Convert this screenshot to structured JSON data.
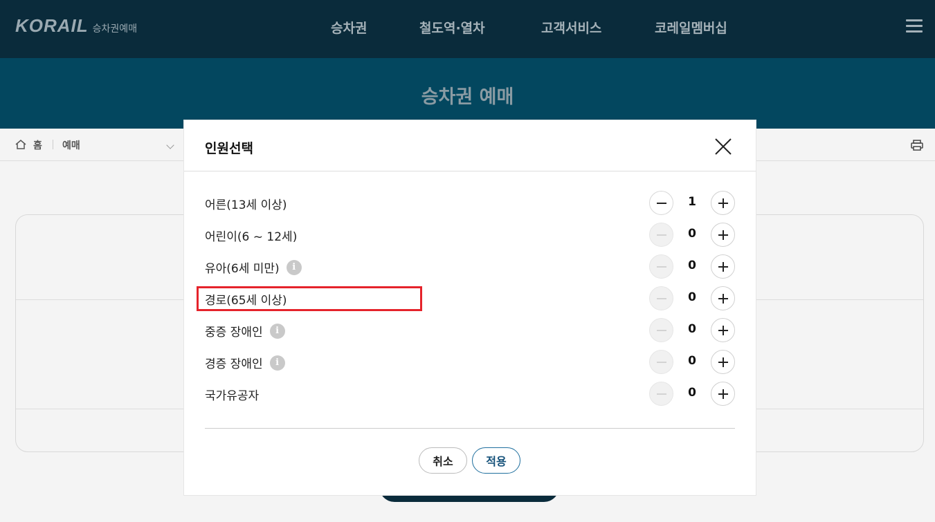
{
  "header": {
    "logo": "KORAIL",
    "logo_sub": "승차권예매",
    "nav": [
      "승차권",
      "철도역·열차",
      "고객서비스",
      "코레일멤버십"
    ]
  },
  "hero": {
    "title": "승차권 예매"
  },
  "breadcrumb": {
    "home": "홈",
    "current": "예매"
  },
  "modal": {
    "title": "인원선택",
    "passengers": [
      {
        "label": "어른(13세 이상)",
        "count": "1",
        "info": false,
        "minus_enabled": true
      },
      {
        "label": "어린이(6 ~ 12세)",
        "count": "0",
        "info": false,
        "minus_enabled": false
      },
      {
        "label": "유아(6세 미만)",
        "count": "0",
        "info": true,
        "minus_enabled": false
      },
      {
        "label": "경로(65세 이상)",
        "count": "0",
        "info": false,
        "minus_enabled": false
      },
      {
        "label": "중증 장애인",
        "count": "0",
        "info": true,
        "minus_enabled": false
      },
      {
        "label": "경증 장애인",
        "count": "0",
        "info": true,
        "minus_enabled": false
      },
      {
        "label": "국가유공자",
        "count": "0",
        "info": false,
        "minus_enabled": false
      }
    ],
    "info_glyph": "i",
    "cancel_label": "취소",
    "apply_label": "적용"
  },
  "colors": {
    "header": "#0a2b3b",
    "hero": "#03475f",
    "highlight": "#e5232b",
    "apply": "#15517a"
  }
}
